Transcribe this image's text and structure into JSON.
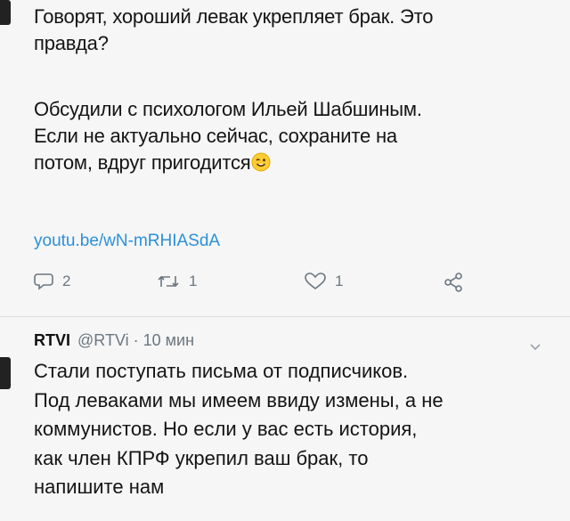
{
  "tweet": {
    "lines": [
      "Говорят, хороший левак укрепляет брак. Это",
      "правда?",
      "",
      "Обсудили с психологом Ильей Шабшиным.",
      "Если не актуально сейчас, сохраните на",
      "потом, вдруг пригодится"
    ],
    "emoji": "wink-face",
    "link": "youtu.be/wN-mRHIASdA",
    "replies": "2",
    "retweets": "1",
    "likes": "1"
  },
  "reply_tweet": {
    "name": "RTVI",
    "handle": "@RTVi · 10 мин",
    "lines": [
      "Стали поступать письма от подписчиков.",
      "Под леваками мы имеем ввиду измены, а не",
      "коммунистов. Но если у вас есть история,",
      "как член КПРФ укрепил ваш брак, то",
      "напишите нам"
    ]
  },
  "colors": {
    "link": "#2b90d9",
    "muted": "#6b7680",
    "text": "#141414"
  }
}
